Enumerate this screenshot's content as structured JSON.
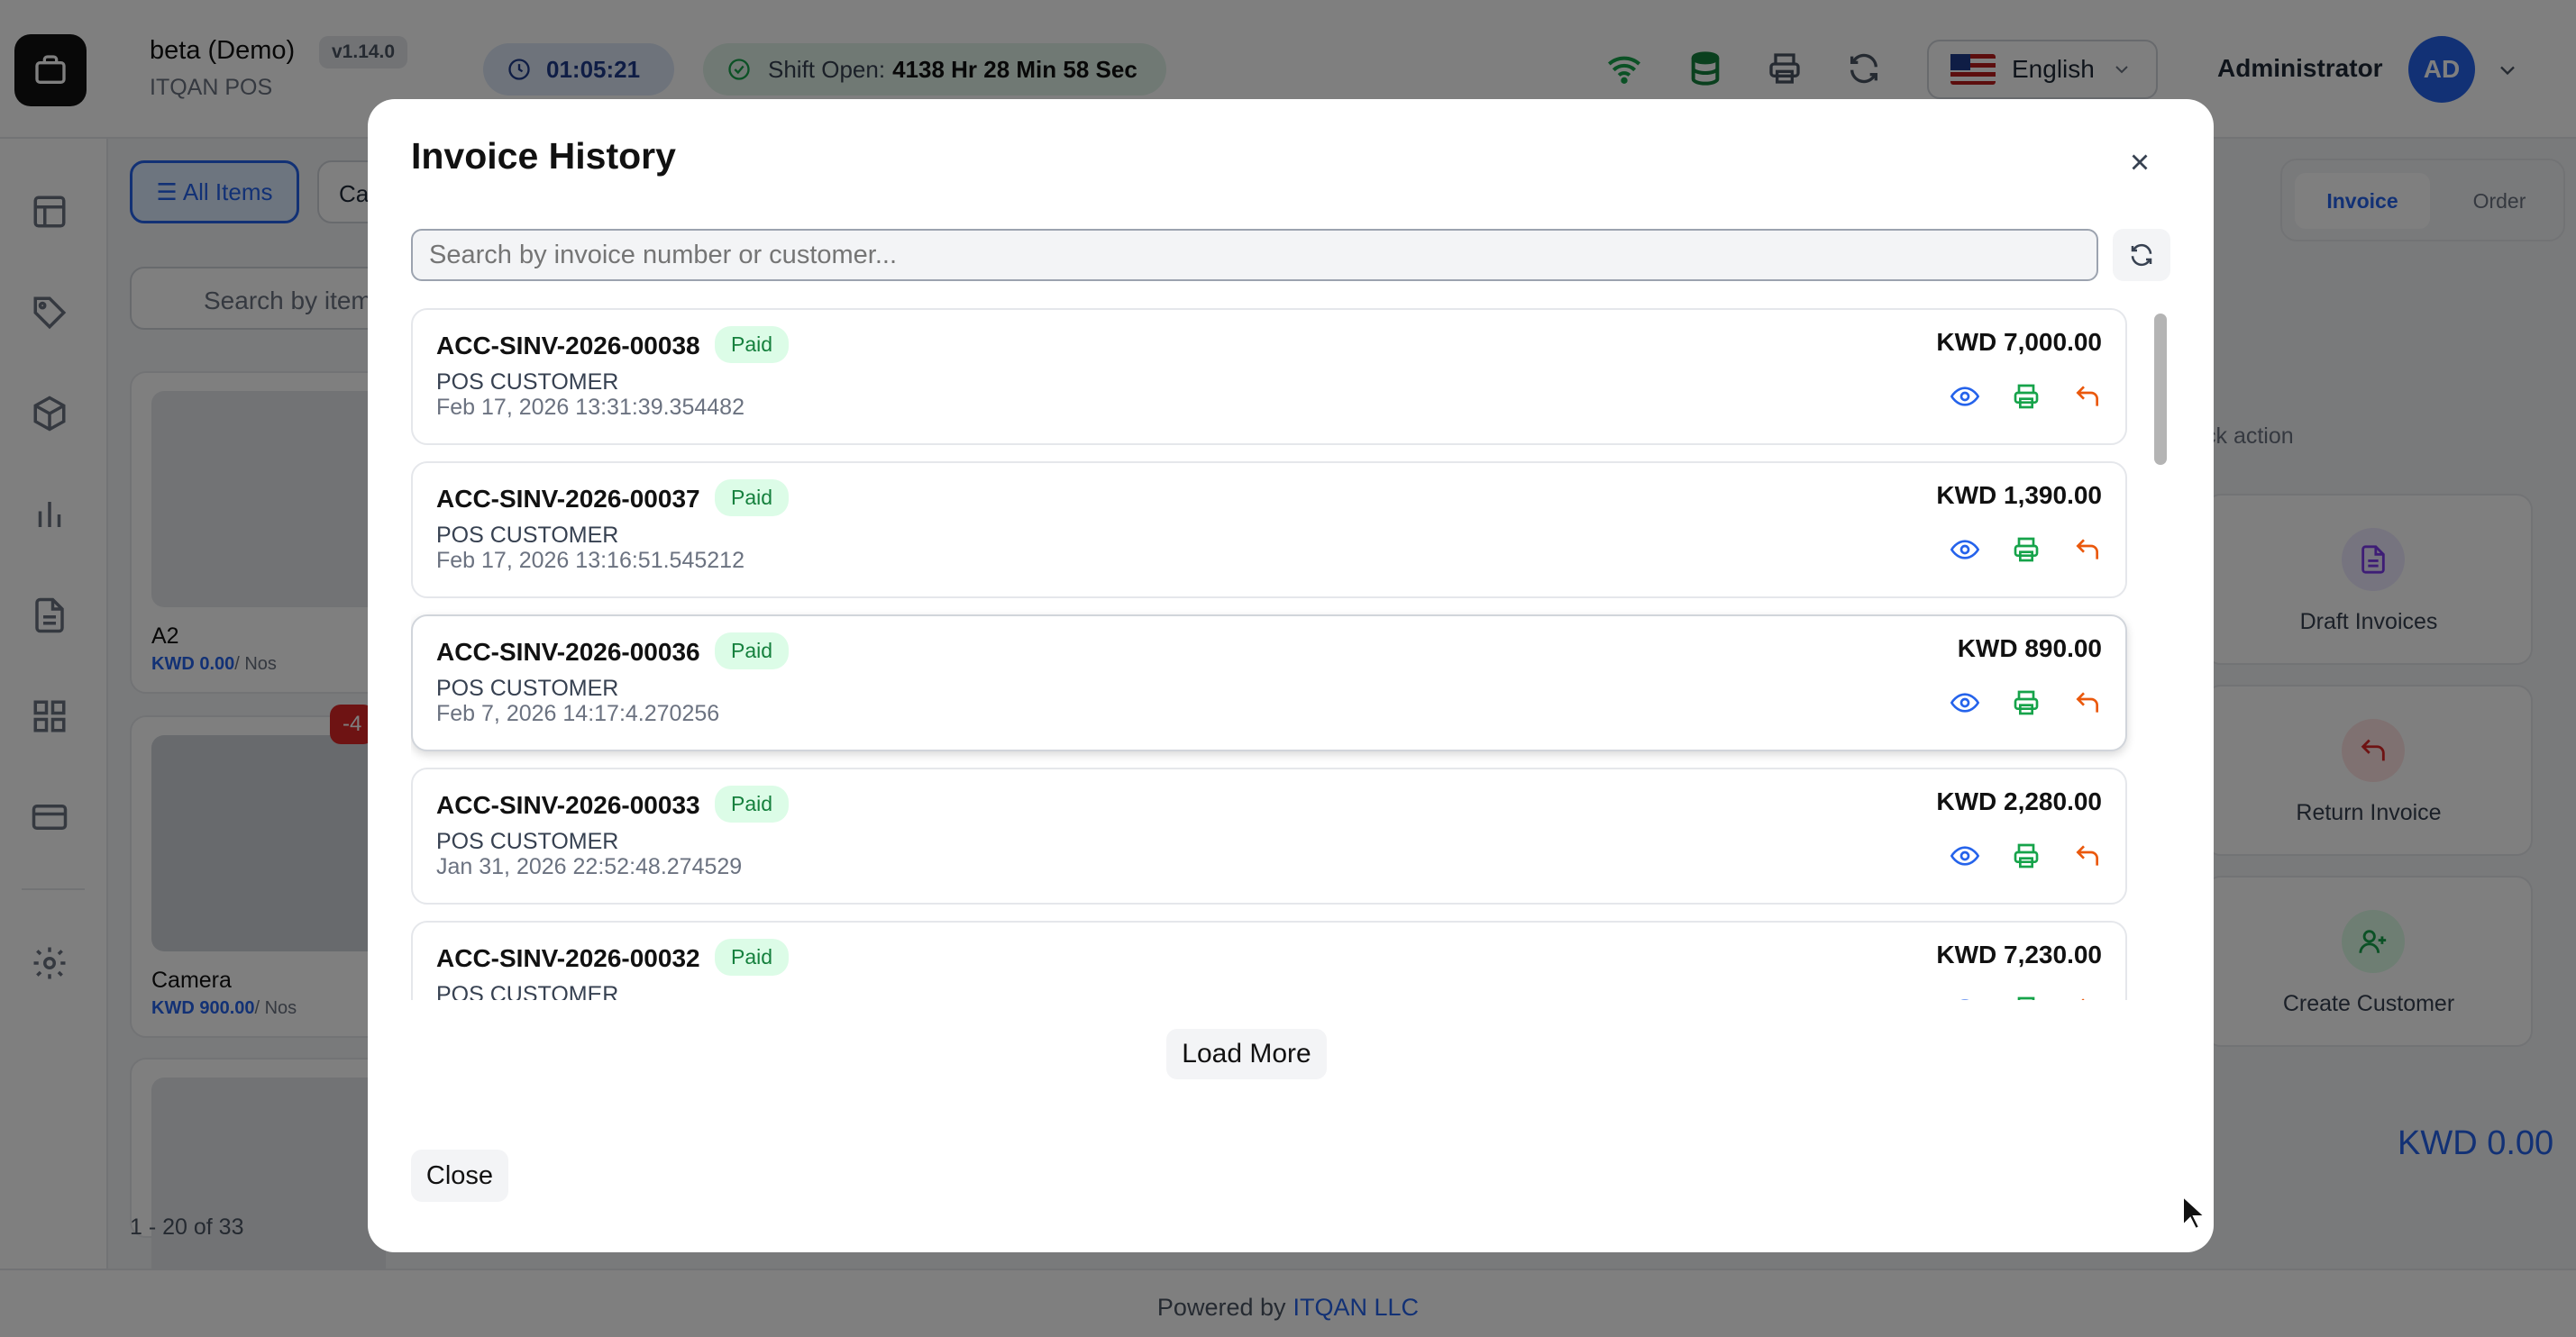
{
  "header": {
    "app_name": "beta (Demo)",
    "app_sub": "ITQAN POS",
    "version": "v1.14.0",
    "timer": "01:05:21",
    "shift_label": "Shift Open:",
    "shift_value": "4138 Hr 28 Min 58 Sec",
    "language": "English",
    "user": "Administrator",
    "avatar_initials": "AD"
  },
  "items_panel": {
    "all_items": "All Items",
    "category_tab": "Ca",
    "search_placeholder": "Search by item",
    "items": [
      {
        "name": "A2",
        "price": "KWD 0.00",
        "unit": "/ Nos"
      },
      {
        "name": "Camera",
        "price": "KWD 900.00",
        "unit": "/ Nos",
        "badge": "-4"
      }
    ],
    "pager": "1 - 20 of 33"
  },
  "right_panel": {
    "seg_invoice": "Invoice",
    "seg_order": "Order",
    "quick_action_label": "ck action",
    "actions": [
      {
        "label": "Draft Invoices",
        "icon": "document-icon"
      },
      {
        "label": "Return Invoice",
        "icon": "return-icon"
      },
      {
        "label": "Create Customer",
        "icon": "add-user-icon"
      }
    ],
    "total": "KWD 0.00"
  },
  "footer": {
    "powered_by": "Powered by",
    "company": "ITQAN LLC"
  },
  "modal": {
    "title": "Invoice History",
    "search_placeholder": "Search by invoice number or customer...",
    "invoices": [
      {
        "number": "ACC-SINV-2026-00038",
        "status": "Paid",
        "customer": "POS CUSTOMER",
        "date": "Feb 17, 2026 13:31:39.354482",
        "amount": "KWD 7,000.00"
      },
      {
        "number": "ACC-SINV-2026-00037",
        "status": "Paid",
        "customer": "POS CUSTOMER",
        "date": "Feb 17, 2026 13:16:51.545212",
        "amount": "KWD 1,390.00"
      },
      {
        "number": "ACC-SINV-2026-00036",
        "status": "Paid",
        "customer": "POS CUSTOMER",
        "date": "Feb 7, 2026 14:17:4.270256",
        "amount": "KWD 890.00"
      },
      {
        "number": "ACC-SINV-2026-00033",
        "status": "Paid",
        "customer": "POS CUSTOMER",
        "date": "Jan 31, 2026 22:52:48.274529",
        "amount": "KWD 2,280.00"
      },
      {
        "number": "ACC-SINV-2026-00032",
        "status": "Paid",
        "customer": "POS CUSTOMER",
        "date": "",
        "amount": "KWD 7,230.00"
      }
    ],
    "load_more": "Load More",
    "close": "Close"
  }
}
